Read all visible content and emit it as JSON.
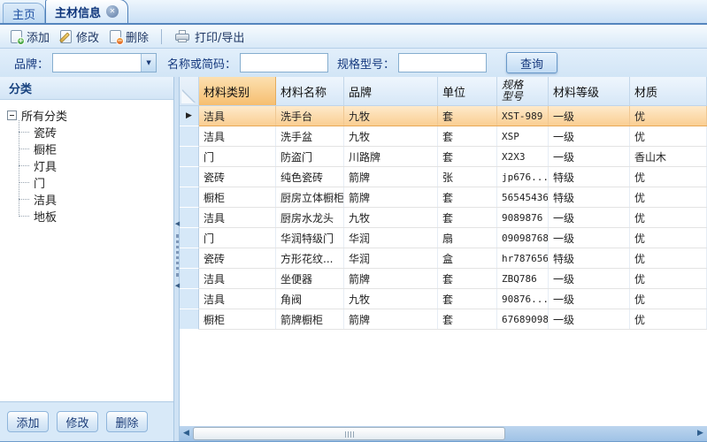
{
  "tab_bar": {
    "tabs": [
      {
        "label": "主页"
      },
      {
        "label": "主材信息"
      }
    ]
  },
  "toolbar": {
    "buttons": [
      {
        "label": "添加"
      },
      {
        "label": "修改"
      },
      {
        "label": "删除"
      },
      {
        "label": "打印/导出"
      }
    ]
  },
  "filter_bar": {
    "brand_label": "品牌：",
    "brand_value": "",
    "name_label": "名称或简码：",
    "name_value": "",
    "spec_label": "规格型号：",
    "spec_value": "",
    "query_button": "查询"
  },
  "sidebar": {
    "title": "分类",
    "tree": {
      "root": "所有分类",
      "children": [
        "瓷砖",
        "橱柜",
        "灯具",
        "门",
        "洁具",
        "地板"
      ]
    },
    "footer_buttons": [
      {
        "label": "添加"
      },
      {
        "label": "修改"
      },
      {
        "label": "删除"
      }
    ]
  },
  "grid": {
    "headers": [
      "材料类别",
      "材料名称",
      "品牌",
      "单位",
      "规格型号",
      "材料等级",
      "材质"
    ],
    "selected_row_index": 0,
    "rows": [
      [
        "洁具",
        "洗手台",
        "九牧",
        "套",
        "XST-989",
        "一级",
        "优"
      ],
      [
        "洁具",
        "洗手盆",
        "九牧",
        "套",
        "XSP",
        "一级",
        "优"
      ],
      [
        "门",
        "防盗门",
        "川路牌",
        "套",
        "X2X3",
        "一级",
        "香山木"
      ],
      [
        "瓷砖",
        "纯色瓷砖",
        "箭牌",
        "张",
        "jp676...",
        "特级",
        "优"
      ],
      [
        "橱柜",
        "厨房立体橱柜",
        "箭牌",
        "套",
        "56545436",
        "特级",
        "优"
      ],
      [
        "洁具",
        "厨房水龙头",
        "九牧",
        "套",
        "9089876",
        "一级",
        "优"
      ],
      [
        "门",
        "华润特级门",
        "华润",
        "扇",
        "09098768",
        "一级",
        "优"
      ],
      [
        "瓷砖",
        "方形花纹...",
        "华润",
        "盒",
        "hr787656",
        "特级",
        "优"
      ],
      [
        "洁具",
        "坐便器",
        "箭牌",
        "套",
        "ZBQ786",
        "一级",
        "优"
      ],
      [
        "洁具",
        "角阀",
        "九牧",
        "套",
        "90876...",
        "一级",
        "优"
      ],
      [
        "橱柜",
        "箭牌橱柜",
        "箭牌",
        "套",
        "67689098",
        "一级",
        "优"
      ]
    ]
  },
  "icons": {
    "close_tab": "✕",
    "combo_arrow": "▼",
    "row_selected_arrow": "▶",
    "scroll_left_arrow": "◀",
    "scroll_right_arrow": "▶",
    "splitter_collapse_arrow": "◀"
  },
  "colors": {
    "accent_navy": "#15397E",
    "sorted_header_orange": "#F6BE70",
    "selected_row_orange": "#FACE92",
    "panel_blue": "#D8E9F8"
  }
}
